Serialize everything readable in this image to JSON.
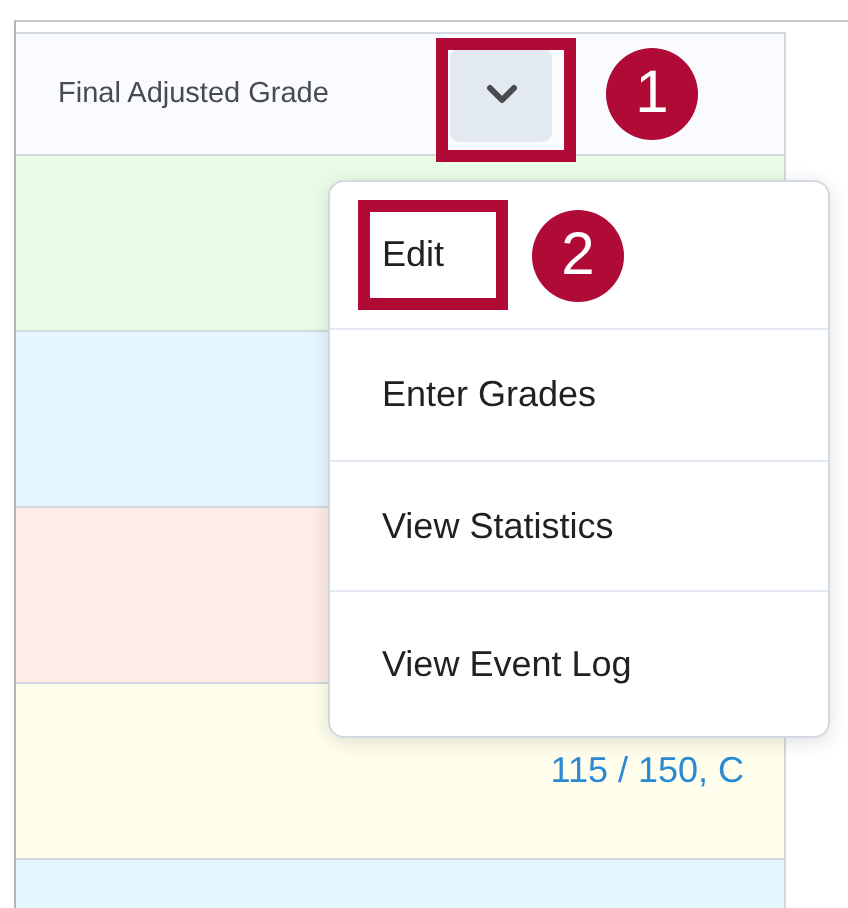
{
  "column": {
    "header": "Final Adjusted Grade",
    "menu_button": {
      "expanded": true
    }
  },
  "rows": [
    {
      "color": "#e8fce6"
    },
    {
      "color": "#e6f6fe"
    },
    {
      "color": "#fdede6"
    },
    {
      "color": "#fffdeb",
      "grade": "115 / 150, C"
    },
    {
      "color": "#e6f6fe"
    }
  ],
  "menu": {
    "items": [
      "Edit",
      "Enter Grades",
      "View Statistics",
      "View Event Log"
    ]
  },
  "callouts": [
    {
      "number": "1",
      "kind": "button"
    },
    {
      "number": "2",
      "kind": "item"
    }
  ]
}
